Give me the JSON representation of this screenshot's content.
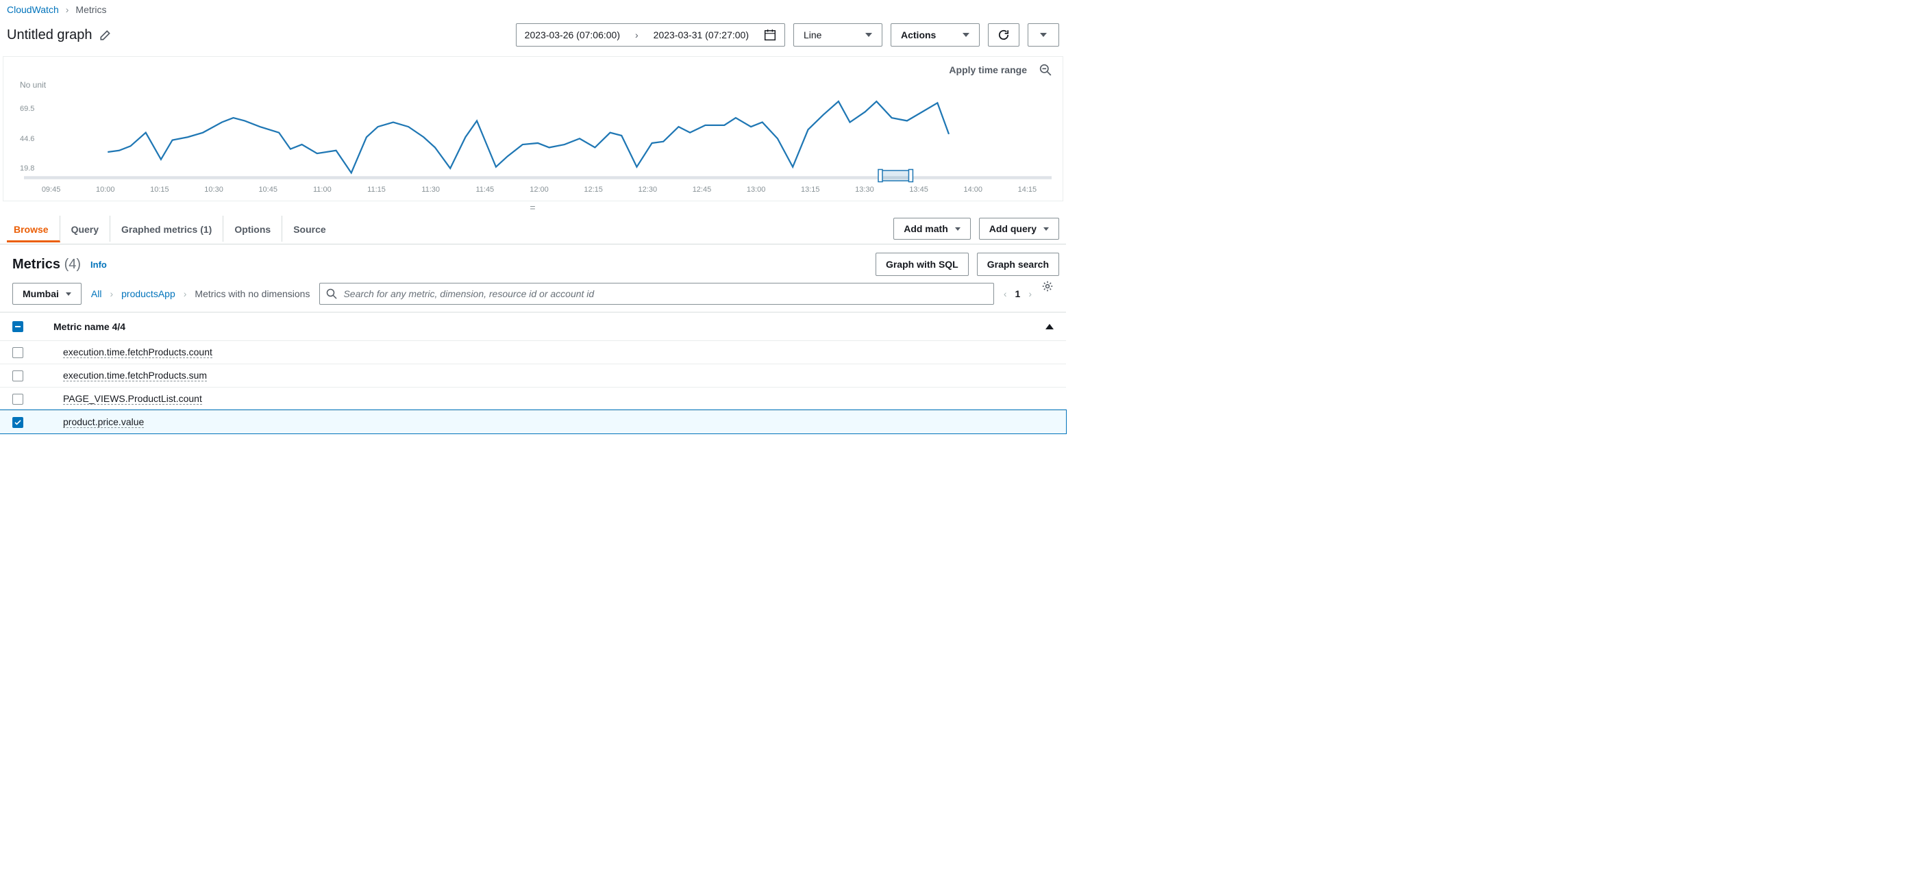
{
  "breadcrumb": {
    "root": "CloudWatch",
    "current": "Metrics"
  },
  "graph": {
    "title": "Untitled graph",
    "apply_time_range": "Apply time range"
  },
  "date_range": {
    "from": "2023-03-26 (07:06:00)",
    "to": "2023-03-31 (07:27:00)"
  },
  "controls": {
    "chart_type": "Line",
    "actions": "Actions",
    "add_math": "Add math",
    "add_query": "Add query",
    "graph_sql": "Graph with SQL",
    "graph_search": "Graph search"
  },
  "tabs": {
    "browse": "Browse",
    "query": "Query",
    "graphed_metrics": "Graphed metrics (1)",
    "options": "Options",
    "source": "Source"
  },
  "metrics_section": {
    "heading": "Metrics",
    "count_display": "(4)",
    "info": "Info"
  },
  "filters": {
    "region": "Mumbai",
    "path_all": "All",
    "path_namespace": "productsApp",
    "path_dim": "Metrics with no dimensions",
    "search_placeholder": "Search for any metric, dimension, resource id or account id",
    "page": "1"
  },
  "table": {
    "header": "Metric name 4/4",
    "rows": [
      {
        "name": "execution.time.fetchProducts.count",
        "checked": false
      },
      {
        "name": "execution.time.fetchProducts.sum",
        "checked": false
      },
      {
        "name": "PAGE_VIEWS.ProductList.count",
        "checked": false
      },
      {
        "name": "product.price.value",
        "checked": true
      }
    ]
  },
  "chart_data": {
    "type": "line",
    "title": "",
    "ylabel": "No unit",
    "xlabel": "",
    "y_ticks": [
      19.8,
      44.6,
      69.5
    ],
    "x_ticks": [
      "09:45",
      "10:00",
      "10:15",
      "10:30",
      "10:45",
      "11:00",
      "11:15",
      "11:30",
      "11:45",
      "12:00",
      "12:15",
      "12:30",
      "12:45",
      "13:00",
      "13:15",
      "13:30",
      "13:45",
      "14:00",
      "14:15"
    ],
    "series": [
      {
        "name": "product.price.value",
        "color": "#1f77b4",
        "x": [
          "10:07",
          "10:10",
          "10:13",
          "10:17",
          "10:21",
          "10:24",
          "10:28",
          "10:32",
          "10:37",
          "10:40",
          "10:43",
          "10:47",
          "10:52",
          "10:55",
          "10:58",
          "11:02",
          "11:07",
          "11:11",
          "11:15",
          "11:18",
          "11:22",
          "11:26",
          "11:30",
          "11:33",
          "11:37",
          "11:41",
          "11:44",
          "11:49",
          "11:52",
          "11:56",
          "12:00",
          "12:03",
          "12:07",
          "12:11",
          "12:15",
          "12:19",
          "12:22",
          "12:26",
          "12:30",
          "12:33",
          "12:37",
          "12:40",
          "12:44",
          "12:49",
          "12:52",
          "12:56",
          "12:59",
          "13:03",
          "13:07",
          "13:11",
          "13:15",
          "13:19",
          "13:22",
          "13:26",
          "13:29",
          "13:33",
          "13:37",
          "13:41",
          "13:45",
          "13:48"
        ],
        "values": [
          35,
          36,
          39,
          48,
          30,
          43,
          45,
          48,
          55,
          58,
          56,
          52,
          48,
          37,
          40,
          34,
          36,
          21,
          45,
          52,
          55,
          52,
          45,
          38,
          24,
          45,
          56,
          25,
          32,
          40,
          41,
          38,
          40,
          44,
          38,
          48,
          46,
          25,
          41,
          42,
          52,
          48,
          53,
          53,
          58,
          52,
          55,
          44,
          25,
          50,
          60,
          69,
          55,
          62,
          69,
          58,
          56,
          62,
          68,
          47
        ]
      }
    ],
    "brush_range": [
      "13:30",
      "13:38"
    ]
  }
}
